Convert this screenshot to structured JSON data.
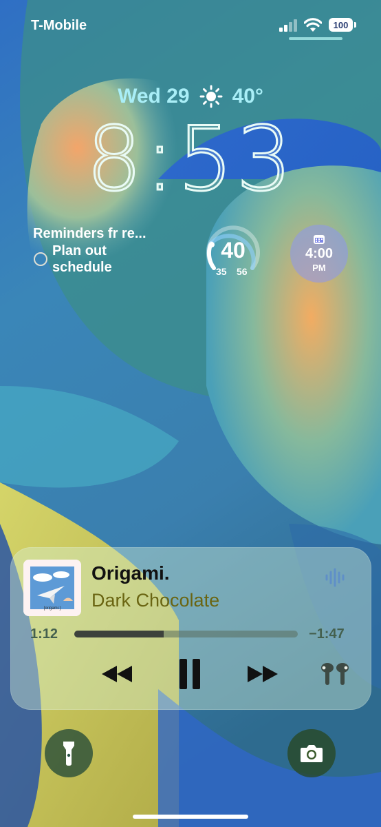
{
  "status_bar": {
    "carrier": "T-Mobile",
    "battery_level": "100",
    "signal_bars": 2,
    "icons": [
      "signal-icon",
      "wifi-icon",
      "battery-icon"
    ]
  },
  "lock_screen": {
    "date": "Wed 29",
    "weather_icon": "sun-icon",
    "weather_temp": "40°",
    "time": "8:53"
  },
  "widgets": {
    "reminders": {
      "title": "Reminders fr re...",
      "item": "Plan out schedule"
    },
    "temperature": {
      "current": "40",
      "low": "35",
      "high": "56"
    },
    "alarm": {
      "icon": "alarm-calendar-icon",
      "time": "4:00",
      "ampm": "PM"
    }
  },
  "now_playing": {
    "title": "Origami.",
    "artist": "Dark Chocolate",
    "artwork_caption": "[origami.]",
    "elapsed": "1:12",
    "remaining": "−1:47",
    "progress": 0.4,
    "controls": [
      "rewind-icon",
      "pause-icon",
      "fast-forward-icon",
      "airpods-icon"
    ],
    "accent": "#6a6512"
  },
  "bottom_actions": {
    "left": "flashlight-icon",
    "right": "camera-icon"
  }
}
